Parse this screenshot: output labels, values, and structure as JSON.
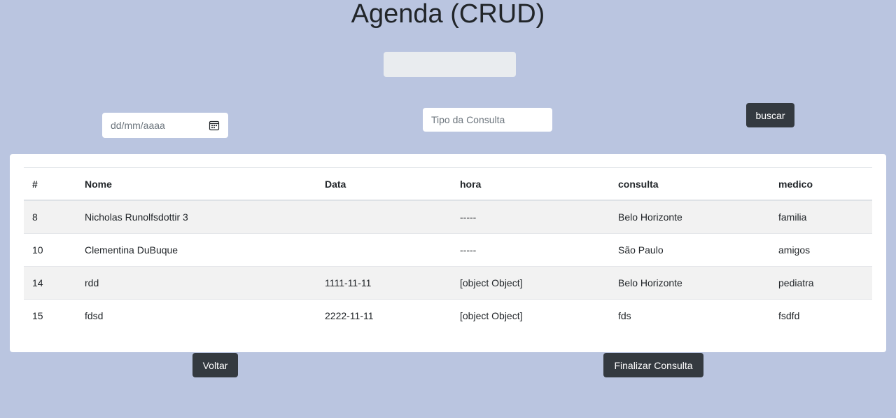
{
  "page": {
    "title": "Agenda (CRUD)"
  },
  "filters": {
    "top_field_value": "",
    "date_placeholder": "dd/mm/aaaa",
    "tipo_placeholder": "Tipo da Consulta",
    "search_label": "buscar"
  },
  "table": {
    "columns": [
      "#",
      "Nome",
      "Data",
      "hora",
      "consulta",
      "medico"
    ],
    "rows": [
      {
        "id": "8",
        "nome": "Nicholas Runolfsdottir 3",
        "data": "",
        "hora": "-----",
        "consulta": "Belo Horizonte",
        "medico": "familia"
      },
      {
        "id": "10",
        "nome": "Clementina DuBuque",
        "data": "",
        "hora": "-----",
        "consulta": "São Paulo",
        "medico": "amigos"
      },
      {
        "id": "14",
        "nome": "rdd",
        "data": "1111-11-11",
        "hora": "[object Object]",
        "consulta": "Belo Horizonte",
        "medico": "pediatra"
      },
      {
        "id": "15",
        "nome": "fdsd",
        "data": "2222-11-11",
        "hora": "[object Object]",
        "consulta": "fds",
        "medico": "fsdfd"
      }
    ]
  },
  "actions": {
    "back_label": "Voltar",
    "finish_label": "Finalizar Consulta"
  },
  "colors": {
    "background": "#bac5e0",
    "button_dark": "#343a40",
    "row_striped": "#f2f2f2"
  },
  "icons": {
    "date_picker": "calendar-icon"
  }
}
